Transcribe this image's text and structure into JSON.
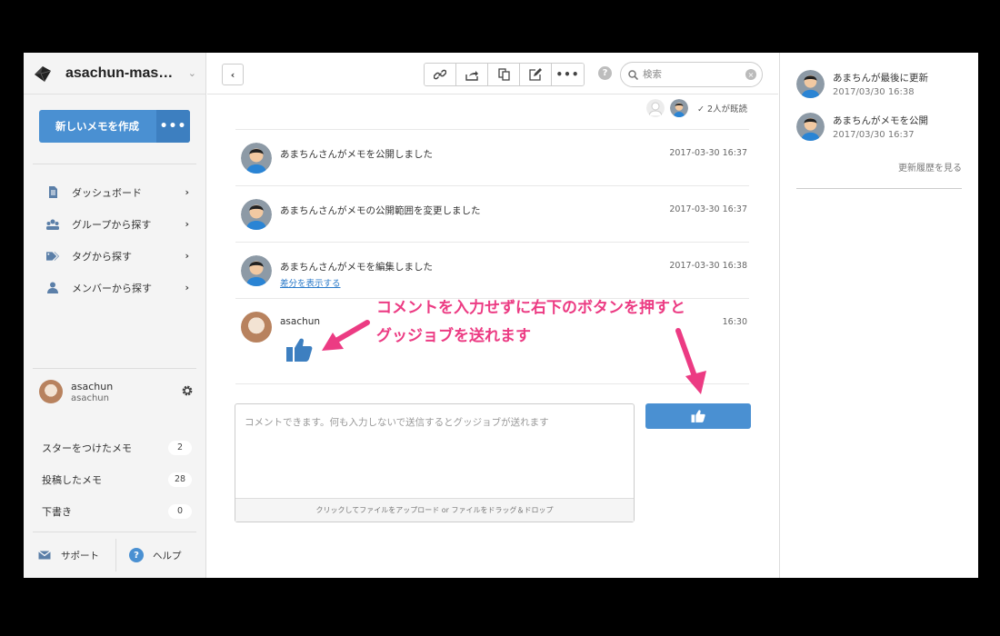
{
  "colors": {
    "accent": "#4a90d2",
    "annotation": "#ec3b83",
    "sidebar_bg": "#f4f4f4"
  },
  "brand": {
    "team_name": "asachun-mas…",
    "logo_icon": "diamond-logo-icon",
    "dropdown_icon": "chevron-down-icon"
  },
  "sidebar": {
    "new_memo_label": "新しいメモを作成",
    "more_label": "•••",
    "nav": [
      {
        "label": "ダッシュボード",
        "icon": "document-icon"
      },
      {
        "label": "グループから探す",
        "icon": "group-icon"
      },
      {
        "label": "タグから探す",
        "icon": "tag-icon"
      },
      {
        "label": "メンバーから探す",
        "icon": "member-icon"
      }
    ],
    "nav_arrow": "›",
    "user": {
      "name": "asachun",
      "handle": "asachun",
      "settings_icon": "gear-icon"
    },
    "stats": [
      {
        "label": "スターをつけたメモ",
        "count": "2"
      },
      {
        "label": "投稿したメモ",
        "count": "28"
      },
      {
        "label": "下書き",
        "count": "0"
      }
    ],
    "footer": {
      "support_label": "サポート",
      "help_label": "ヘルプ"
    }
  },
  "toolbar": {
    "back_label": "‹",
    "tools": [
      "link-icon",
      "share-icon",
      "copy-icon",
      "edit-icon",
      "more-icon"
    ],
    "help_label": "?",
    "search_placeholder": "検索",
    "clear_label": "×"
  },
  "readers": {
    "label": "✓ 2人が既読"
  },
  "timeline": {
    "events": [
      {
        "text": "あまちんさんがメモを公開しました",
        "time": "2017-03-30 16:37"
      },
      {
        "text": "あまちんさんがメモの公開範囲を変更しました",
        "time": "2017-03-30 16:37"
      },
      {
        "text": "あまちんさんがメモを編集しました",
        "time": "2017-03-30 16:38",
        "link": "差分を表示する"
      }
    ],
    "comment": {
      "author": "asachun",
      "time": "16:30",
      "reaction_icon": "thumbs-up-icon"
    }
  },
  "compose": {
    "placeholder": "コメントできます。何も入力しないで送信するとグッジョブが送れます",
    "upload_hint": "クリックしてファイルをアップロード or ファイルをドラッグ＆ドロップ",
    "submit_icon": "thumbs-up-icon"
  },
  "annotation": {
    "line1": "コメントを入力せずに右下のボタンを押すと",
    "line2": "グッジョブを送れます"
  },
  "history": {
    "items": [
      {
        "text": "あまちんが最後に更新",
        "time": "2017/03/30 16:38"
      },
      {
        "text": "あまちんがメモを公開",
        "time": "2017/03/30 16:37"
      }
    ],
    "more_label": "更新履歴を見る"
  }
}
